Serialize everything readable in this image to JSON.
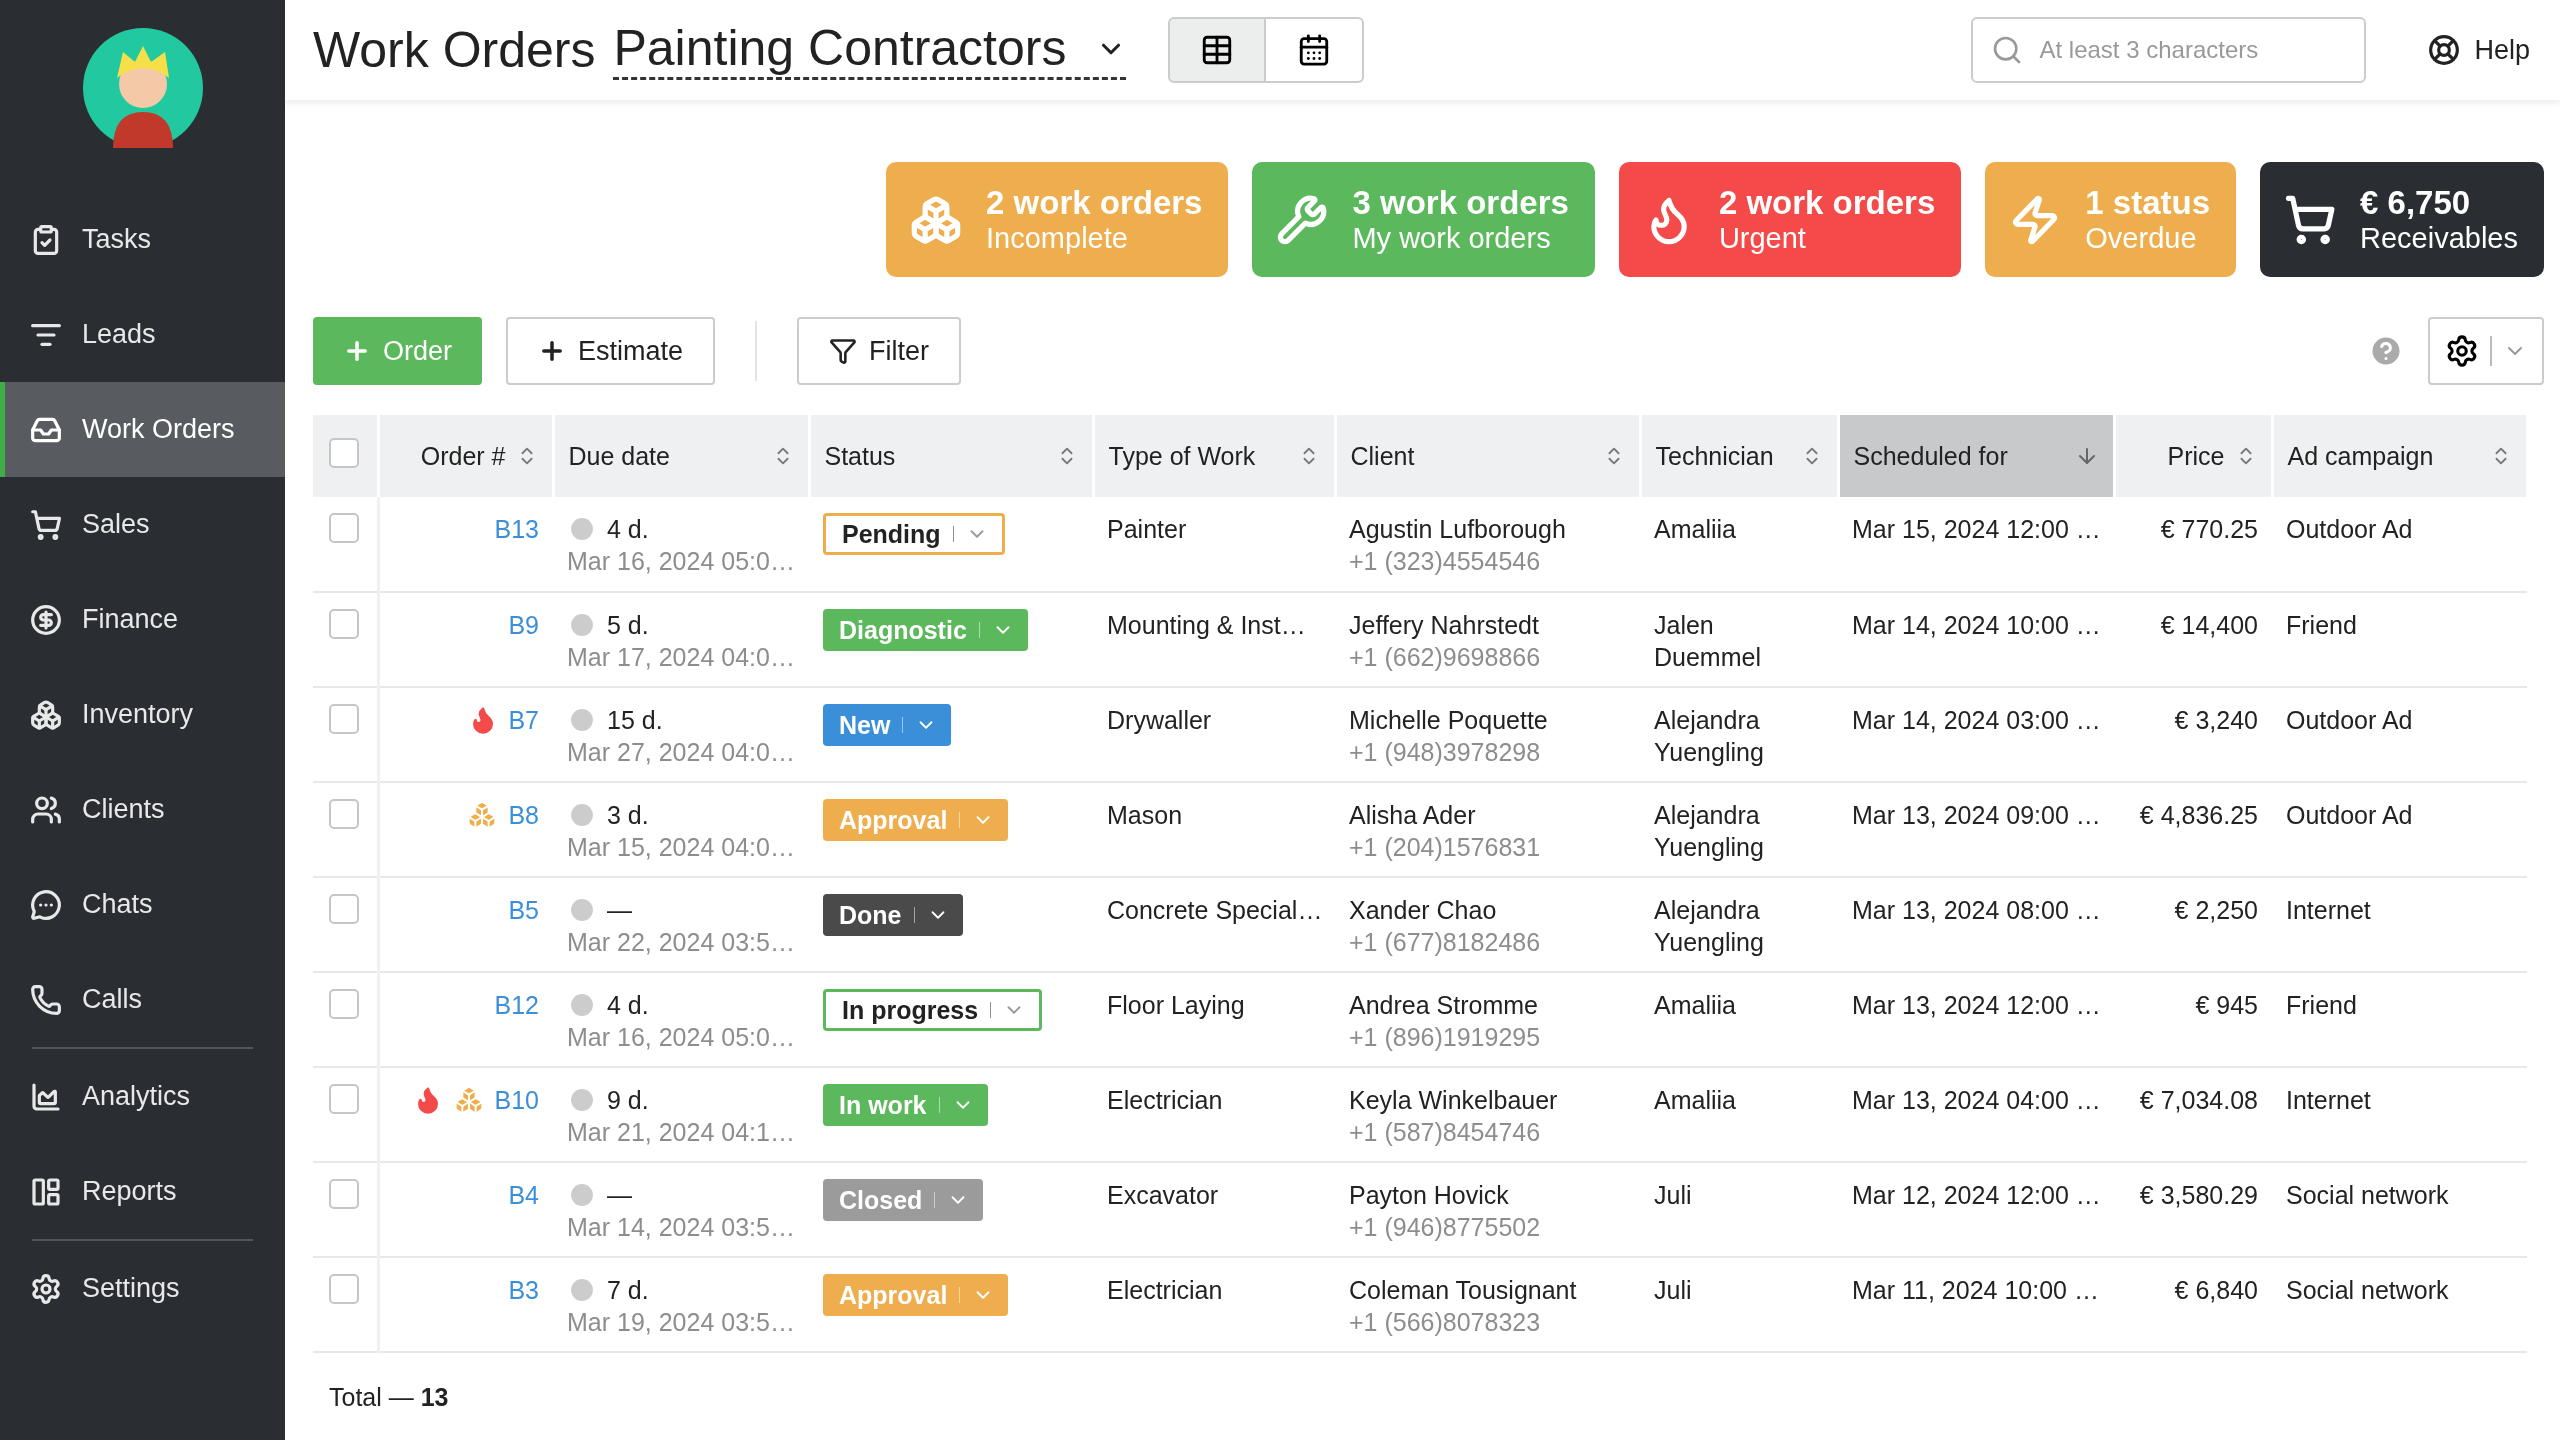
{
  "sidebar": {
    "groups": [
      [
        {
          "label": "Tasks",
          "selected": false
        },
        {
          "label": "Leads",
          "selected": false
        },
        {
          "label": "Work Orders",
          "selected": true
        },
        {
          "label": "Sales",
          "selected": false
        },
        {
          "label": "Finance",
          "selected": false
        },
        {
          "label": "Inventory",
          "selected": false
        },
        {
          "label": "Clients",
          "selected": false
        },
        {
          "label": "Chats",
          "selected": false
        },
        {
          "label": "Calls",
          "selected": false
        }
      ],
      [
        {
          "label": "Analytics",
          "selected": false
        },
        {
          "label": "Reports",
          "selected": false
        }
      ],
      [
        {
          "label": "Settings",
          "selected": false
        }
      ]
    ]
  },
  "header": {
    "title": "Work Orders",
    "pipeline": "Painting Contractors",
    "views": [
      {
        "selected": true
      },
      {
        "selected": false
      }
    ],
    "search": {
      "placeholder": "At least 3 characters"
    },
    "help": "Help"
  },
  "cards": [
    {
      "title": "2 work orders",
      "subtitle": "Incomplete",
      "color": "#efae4e"
    },
    {
      "title": "3 work orders",
      "subtitle": "My work orders",
      "color": "#5cb85c"
    },
    {
      "title": "2 work orders",
      "subtitle": "Urgent",
      "color": "#f44a4a"
    },
    {
      "title": "1 status",
      "subtitle": "Overdue",
      "color": "#efae4e"
    },
    {
      "title": "€ 6,750",
      "subtitle": "Receivables",
      "color": "#2a2e33"
    }
  ],
  "toolbar": {
    "order": "Order",
    "estimate": "Estimate",
    "filter": "Filter"
  },
  "table": {
    "all_checked": false,
    "columns": [
      {
        "label": "Order #",
        "sorted": false
      },
      {
        "label": "Due date",
        "sorted": false
      },
      {
        "label": "Status",
        "sorted": false
      },
      {
        "label": "Type of Work",
        "sorted": false
      },
      {
        "label": "Client",
        "sorted": false
      },
      {
        "label": "Technician",
        "sorted": false
      },
      {
        "label": "Scheduled for",
        "sorted": true
      },
      {
        "label": "Price",
        "sorted": false
      },
      {
        "label": "Ad campaign",
        "sorted": false
      }
    ],
    "rows": [
      {
        "checked": false,
        "urgent": false,
        "incomplete": false,
        "order": "B13",
        "due_in": "4 d.",
        "due_date": "Mar 16, 2024 05:0…",
        "status": {
          "label": "Pending",
          "kind": "outline",
          "color": "#efae4e"
        },
        "type": "Painter",
        "client": "Agustin Lufborough",
        "phone": "+1 (323)4554546",
        "technician": "Amaliia",
        "scheduled": "Mar 15, 2024 12:00 …",
        "price": "€ 770.25",
        "campaign": "Outdoor Ad"
      },
      {
        "checked": false,
        "urgent": false,
        "incomplete": false,
        "order": "B9",
        "due_in": "5 d.",
        "due_date": "Mar 17, 2024 04:0…",
        "status": {
          "label": "Diagnostic",
          "kind": "filled",
          "color": "#5cb85c"
        },
        "type": "Mounting & Inst…",
        "client": "Jeffery Nahrstedt",
        "phone": "+1 (662)9698866",
        "technician": "Jalen Duemmel",
        "scheduled": "Mar 14, 2024 10:00 …",
        "price": "€ 14,400",
        "campaign": "Friend"
      },
      {
        "checked": false,
        "urgent": true,
        "incomplete": false,
        "order": "B7",
        "due_in": "15 d.",
        "due_date": "Mar 27, 2024 04:0…",
        "status": {
          "label": "New",
          "kind": "filled",
          "color": "#3b8fd9"
        },
        "type": "Drywaller",
        "client": "Michelle Poquette",
        "phone": "+1 (948)3978298",
        "technician": "Alejandra Yuengling",
        "scheduled": "Mar 14, 2024 03:00 …",
        "price": "€ 3,240",
        "campaign": "Outdoor Ad"
      },
      {
        "checked": false,
        "urgent": false,
        "incomplete": true,
        "order": "B8",
        "due_in": "3 d.",
        "due_date": "Mar 15, 2024 04:0…",
        "status": {
          "label": "Approval",
          "kind": "filled",
          "color": "#efae4e"
        },
        "type": "Mason",
        "client": "Alisha Ader",
        "phone": "+1 (204)1576831",
        "technician": "Alejandra Yuengling",
        "scheduled": "Mar 13, 2024 09:00 …",
        "price": "€ 4,836.25",
        "campaign": "Outdoor Ad"
      },
      {
        "checked": false,
        "urgent": false,
        "incomplete": false,
        "order": "B5",
        "due_in": "—",
        "due_date": "Mar 22, 2024 03:5…",
        "status": {
          "label": "Done",
          "kind": "filled",
          "color": "#4a4a4a"
        },
        "type": "Concrete Special…",
        "client": "Xander Chao",
        "phone": "+1 (677)8182486",
        "technician": "Alejandra Yuengling",
        "scheduled": "Mar 13, 2024 08:00 …",
        "price": "€ 2,250",
        "campaign": "Internet"
      },
      {
        "checked": false,
        "urgent": false,
        "incomplete": false,
        "order": "B12",
        "due_in": "4 d.",
        "due_date": "Mar 16, 2024 05:0…",
        "status": {
          "label": "In progress",
          "kind": "outline",
          "color": "#5cb85c"
        },
        "type": "Floor Laying",
        "client": "Andrea Stromme",
        "phone": "+1 (896)1919295",
        "technician": "Amaliia",
        "scheduled": "Mar 13, 2024 12:00 …",
        "price": "€ 945",
        "campaign": "Friend"
      },
      {
        "checked": false,
        "urgent": true,
        "incomplete": true,
        "order": "B10",
        "due_in": "9 d.",
        "due_date": "Mar 21, 2024 04:1…",
        "status": {
          "label": "In work",
          "kind": "filled",
          "color": "#5cb85c"
        },
        "type": "Electrician",
        "client": "Keyla Winkelbauer",
        "phone": "+1 (587)8454746",
        "technician": "Amaliia",
        "scheduled": "Mar 13, 2024 04:00 …",
        "price": "€ 7,034.08",
        "campaign": "Internet"
      },
      {
        "checked": false,
        "urgent": false,
        "incomplete": false,
        "order": "B4",
        "due_in": "—",
        "due_date": "Mar 14, 2024 03:5…",
        "status": {
          "label": "Closed",
          "kind": "filled",
          "color": "#9b9b9b"
        },
        "type": "Excavator",
        "client": "Payton Hovick",
        "phone": "+1 (946)8775502",
        "technician": "Juli",
        "scheduled": "Mar 12, 2024 12:00 …",
        "price": "€ 3,580.29",
        "campaign": "Social network"
      },
      {
        "checked": false,
        "urgent": false,
        "incomplete": false,
        "order": "B3",
        "due_in": "7 d.",
        "due_date": "Mar 19, 2024 03:5…",
        "status": {
          "label": "Approval",
          "kind": "filled",
          "color": "#efae4e"
        },
        "type": "Electrician",
        "client": "Coleman Tousignant",
        "phone": "+1 (566)8078323",
        "technician": "Juli",
        "scheduled": "Mar 11, 2024 10:00 …",
        "price": "€ 6,840",
        "campaign": "Social network"
      }
    ]
  },
  "total": "Total — **13**"
}
